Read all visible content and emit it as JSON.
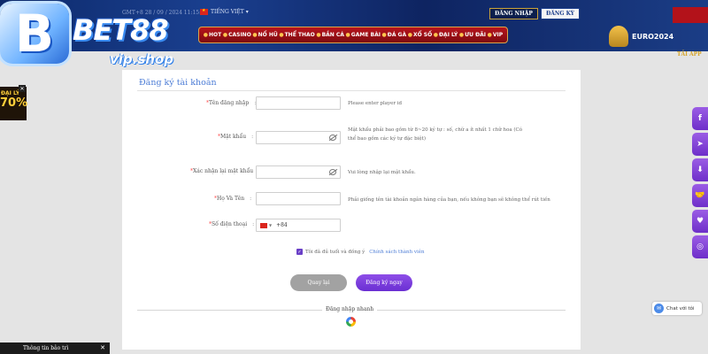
{
  "header": {
    "datetime": "GMT+8 28 / 09 / 2024 11:15:00",
    "language": "TIẾNG VIỆT ▾",
    "login_label": "ĐĂNG NHẬP",
    "register_label": "ĐĂNG KÝ",
    "nav": [
      "HOT",
      "CASINO",
      "NỔ HŨ",
      "THỂ THAO",
      "BẮN CÁ",
      "GAME BÀI",
      "ĐÁ GÀ",
      "XỔ SỐ",
      "ĐẠI LÝ",
      "ƯU ĐÃI",
      "VIP"
    ],
    "euro_label": "EURO2024",
    "tai_api": "TẢI APP"
  },
  "logo": {
    "badge": "B",
    "brand": "BET88",
    "sub": "vip.shop"
  },
  "promo": {
    "top": "ĐẠI LÝ",
    "pct": "70%",
    "close": "✕"
  },
  "form": {
    "title": "Đăng ký tài khoản",
    "fields": [
      {
        "label": "Tên đăng nhập",
        "hint": "Please enter player id"
      },
      {
        "label": "Mật khẩu",
        "hint": "Mật khẩu phải bao gồm từ 8~20 ký tự : số, chữ a ít nhất 1 chữ hoa (Có thể bao gồm các ký tự đặc biệt)"
      },
      {
        "label": "Xác nhận lại mật khẩu",
        "hint": "Vui lòng nhập lại mật khẩu."
      },
      {
        "label": "Họ Và Tên",
        "hint": "Phải giống tên tài khoản ngân hàng của bạn, nếu không bạn sẽ không thể rút tiền"
      },
      {
        "label": "Số điện thoại",
        "hint": ""
      }
    ],
    "phone_code": "+84",
    "agree_text": "Tôi đã đủ tuổi và đồng ý",
    "agree_link": "Chính sách thành viên",
    "back_label": "Quay lại",
    "submit_label": "Đăng ký ngay",
    "quick_login": "Đăng nhập nhanh"
  },
  "social": [
    "f",
    "➤",
    "⬇",
    "🤝",
    "♥",
    "◎"
  ],
  "chat_label": "Chat với tôi",
  "maintenance": {
    "label": "Thông tin bảo trì",
    "close": "✕"
  },
  "colors": {
    "header_bg": "#0d2a6b",
    "nav_red": "#b8141c",
    "accent_purple": "#6a2fd2",
    "link_blue": "#4d7dd6"
  }
}
